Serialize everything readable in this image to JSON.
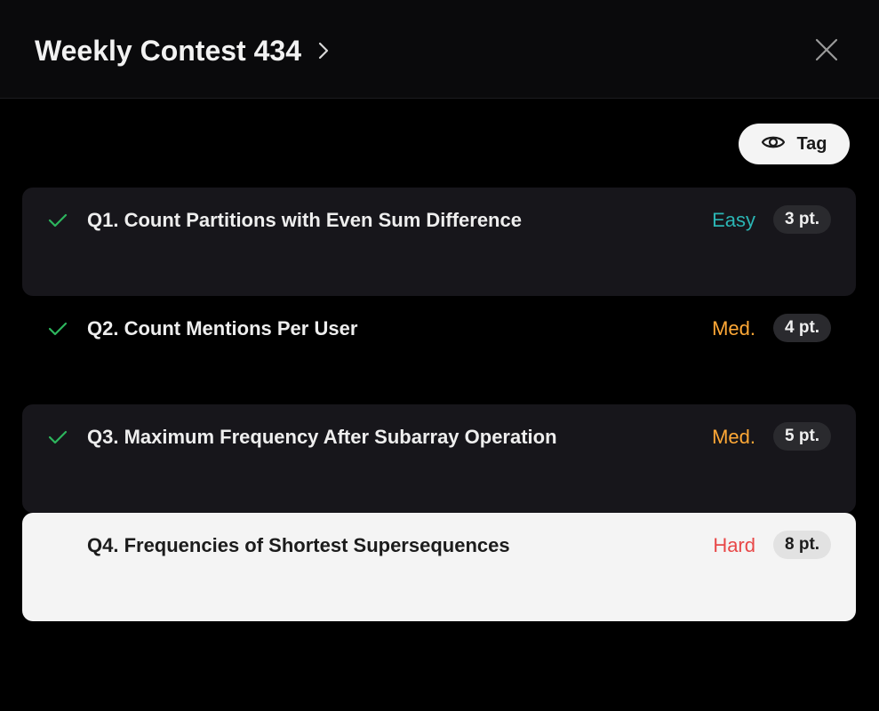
{
  "header": {
    "title": "Weekly Contest 434"
  },
  "toolbar": {
    "tag_label": "Tag"
  },
  "colors": {
    "easy": "#2bb5b4",
    "medium": "#ffa836",
    "hard": "#e84848",
    "check": "#2db55d"
  },
  "questions": [
    {
      "title": "Q1. Count Partitions with Even Sum Difference",
      "difficulty": "Easy",
      "points": "3 pt.",
      "solved": true
    },
    {
      "title": "Q2. Count Mentions Per User",
      "difficulty": "Med.",
      "points": "4 pt.",
      "solved": true
    },
    {
      "title": "Q3. Maximum Frequency After Subarray Operation",
      "difficulty": "Med.",
      "points": "5 pt.",
      "solved": true
    },
    {
      "title": "Q4. Frequencies of Shortest Supersequences",
      "difficulty": "Hard",
      "points": "8 pt.",
      "solved": false
    }
  ]
}
